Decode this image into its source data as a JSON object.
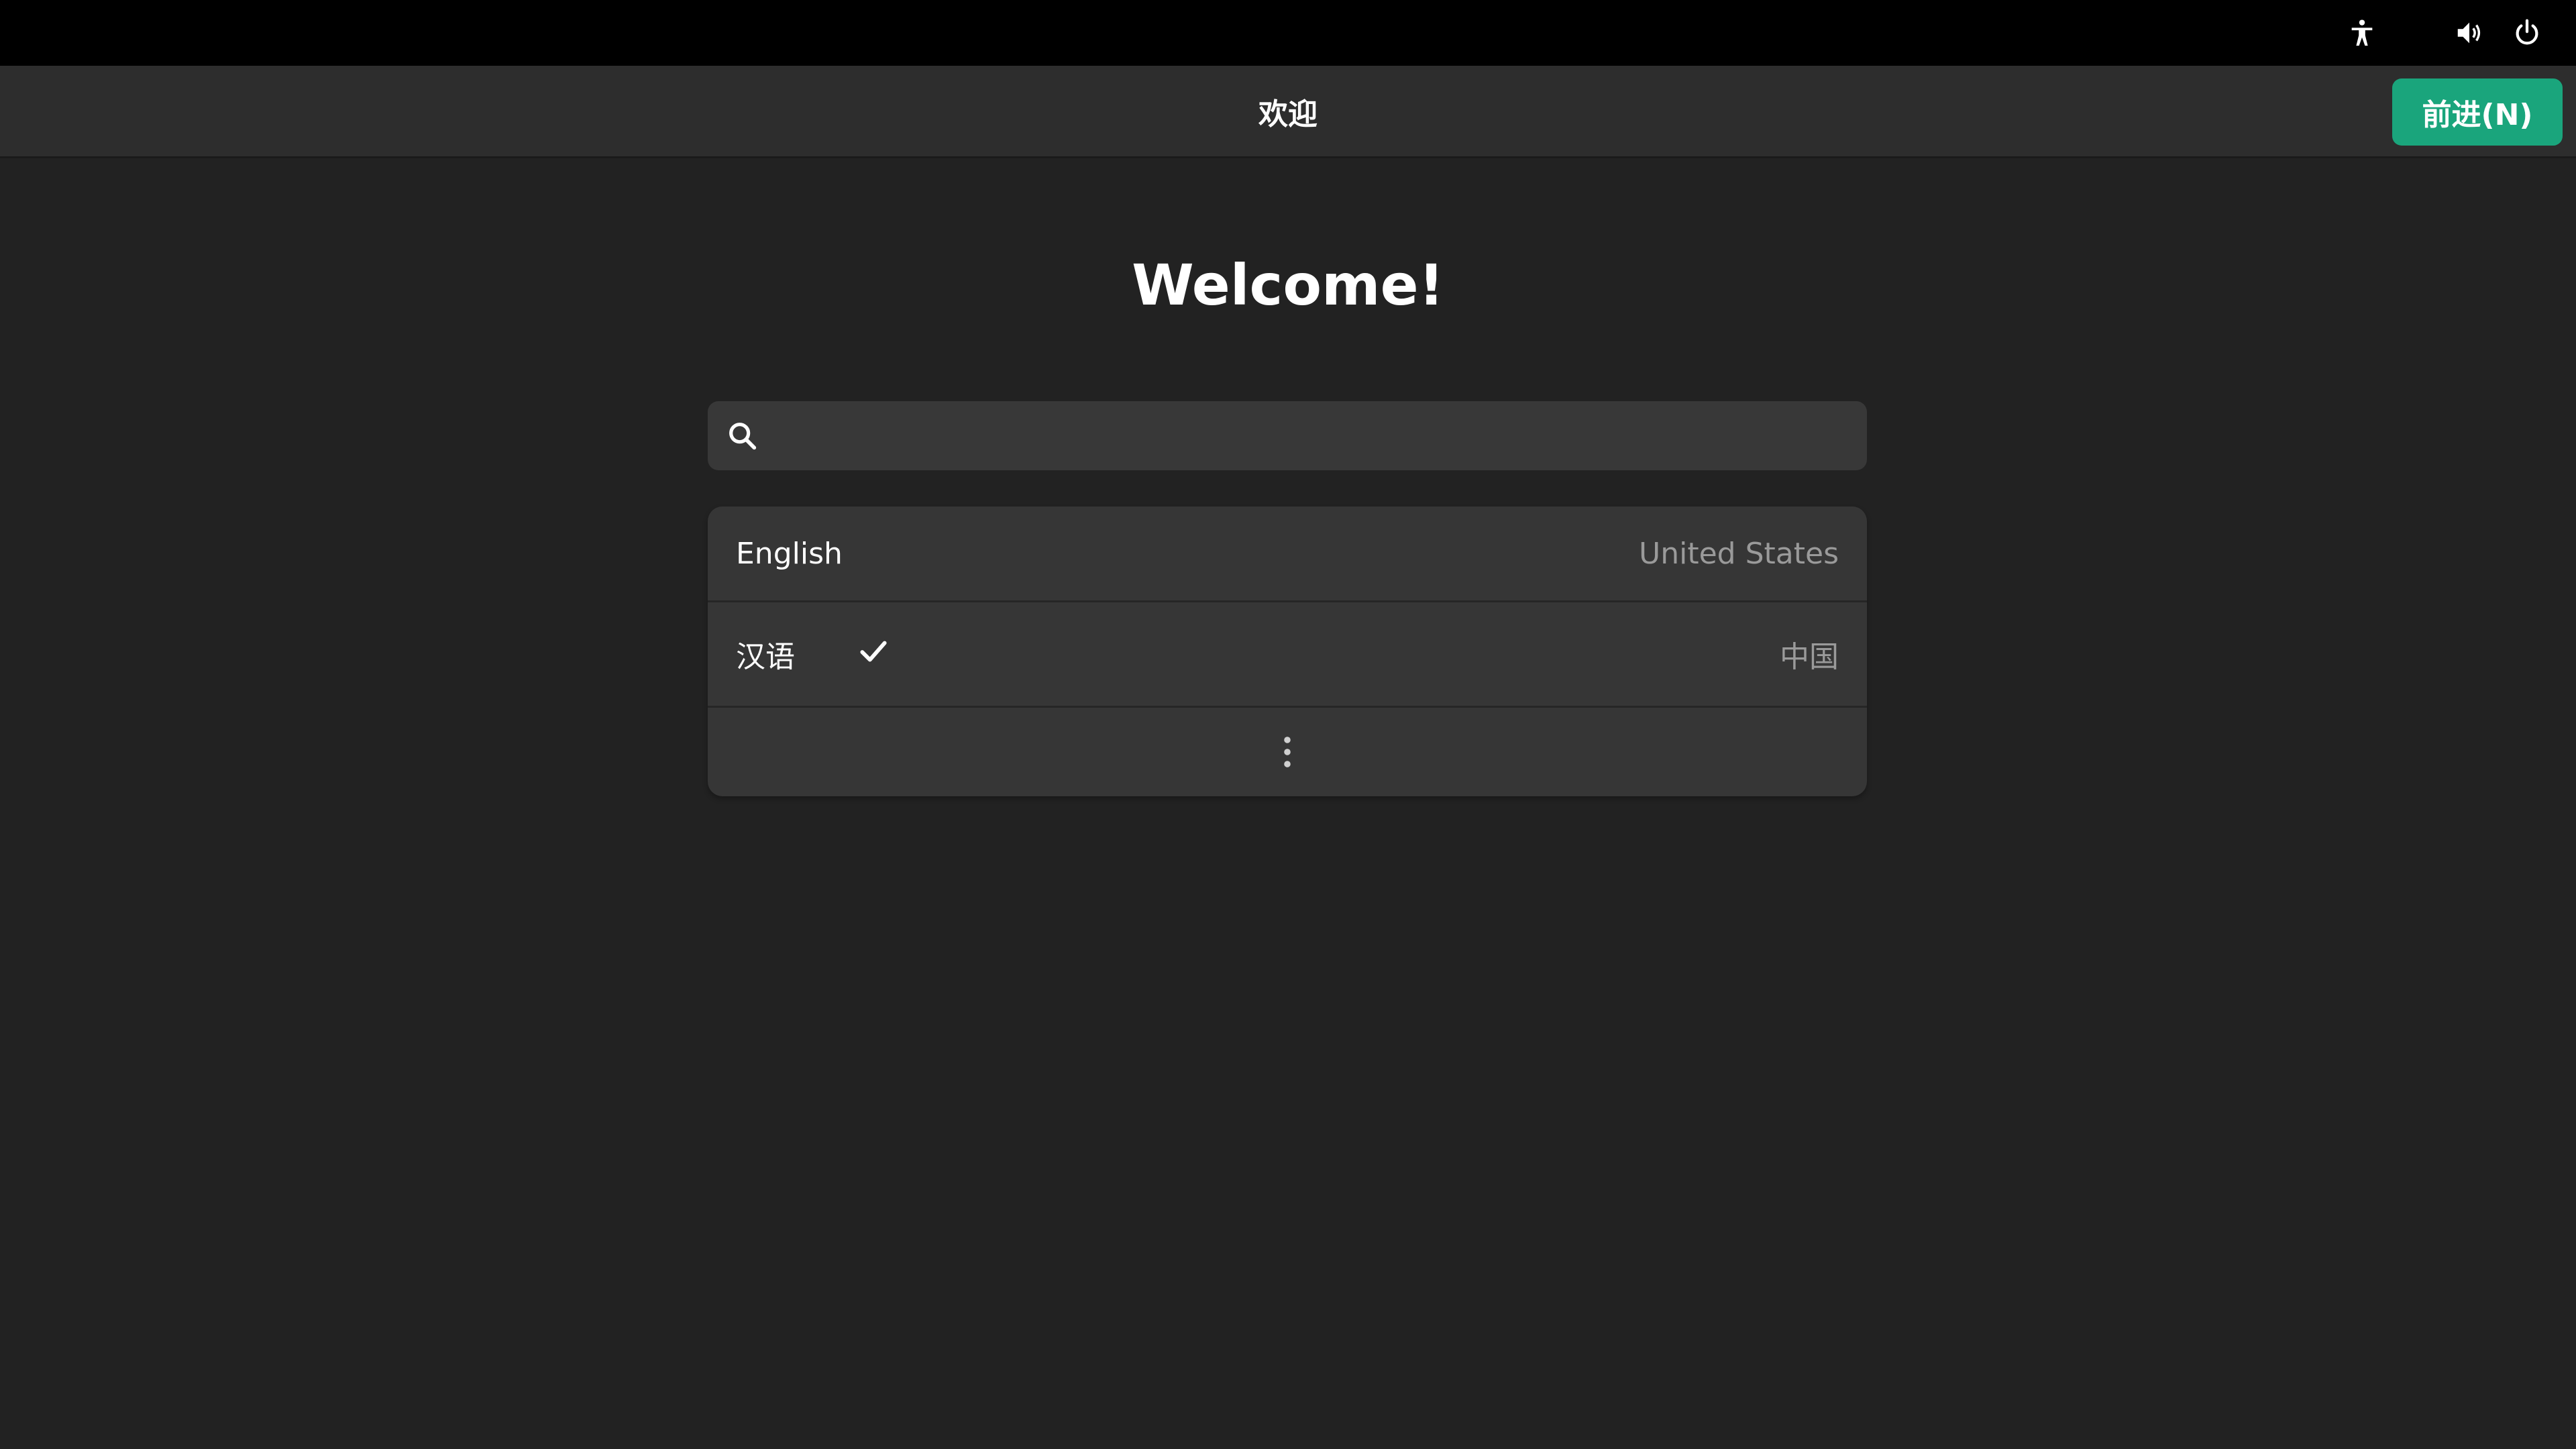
{
  "topbar": {
    "icons": [
      "accessibility-icon",
      "volume-icon",
      "power-icon"
    ]
  },
  "header": {
    "title": "欢迎",
    "next_label": "前进(N)"
  },
  "main": {
    "welcome_title": "Welcome!",
    "search": {
      "value": "",
      "placeholder": "",
      "icon": "search-icon"
    },
    "languages": [
      {
        "name": "English",
        "region": "United States",
        "selected": false
      },
      {
        "name": "汉语",
        "region": "中国",
        "selected": true
      }
    ],
    "more_icon": "more-vertical-icon"
  },
  "colors": {
    "background": "#222222",
    "topbar": "#000000",
    "headerbar": "#2d2d2d",
    "accent": "#1aa57c",
    "list_bg": "#363636",
    "muted_text": "#9a9a9a"
  }
}
